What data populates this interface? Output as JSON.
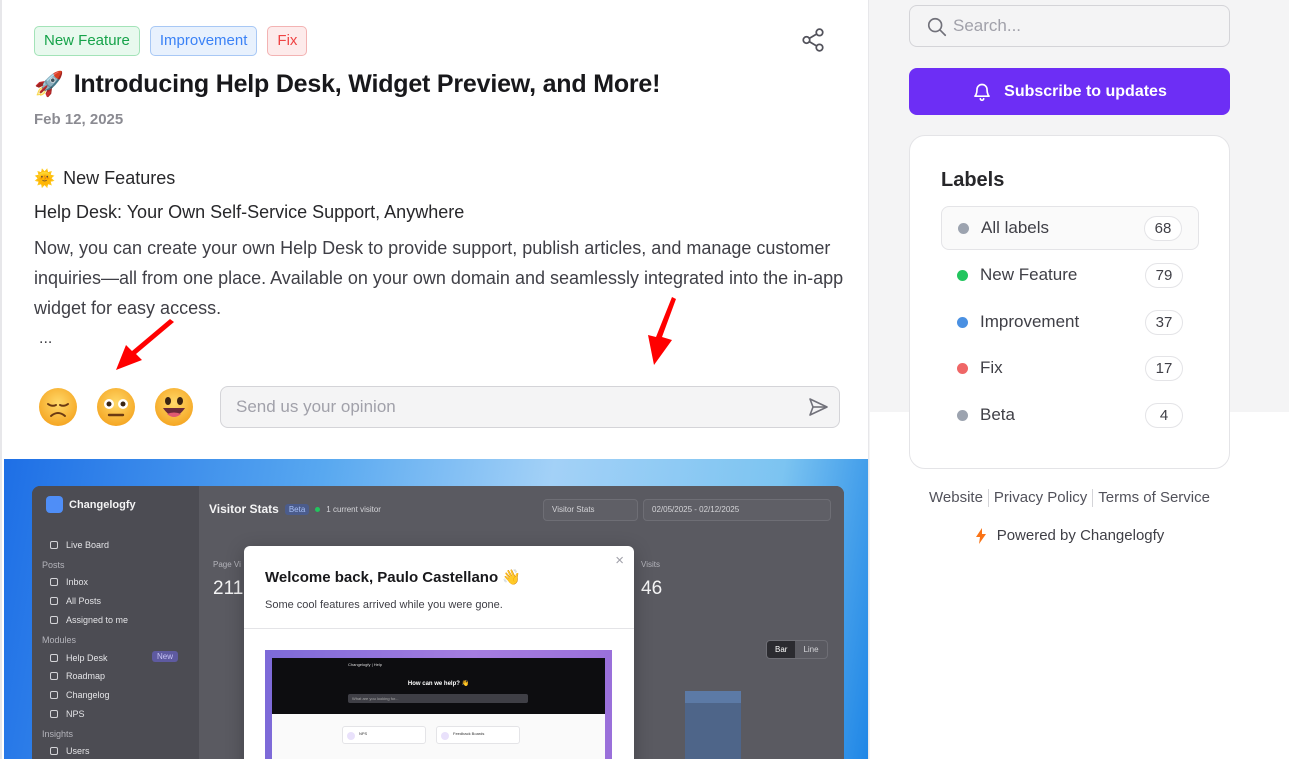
{
  "post": {
    "tags": [
      "New Feature",
      "Improvement",
      "Fix"
    ],
    "title": "Introducing Help Desk, Widget Preview, and More!",
    "title_emoji": "🚀",
    "date": "Feb 12, 2025",
    "section_emoji": "🌞",
    "section_title": "New Features",
    "subtitle": "Help Desk: Your Own Self-Service Support, Anywhere",
    "body": "Now, you can create your own Help Desk to provide support, publish articles, and manage customer inquiries—all from one place. Available on your own domain and seamlessly integrated into the in-app widget for easy access.",
    "ellipsis": "...",
    "opinion_placeholder": "Send us your opinion",
    "reactions": [
      "sad-face-icon",
      "neutral-face-icon",
      "happy-face-icon"
    ]
  },
  "preview": {
    "app_name": "Changelogfy",
    "sidebar": [
      {
        "type": "item",
        "label": "Live Board"
      },
      {
        "type": "group",
        "label": "Posts"
      },
      {
        "type": "item",
        "label": "Inbox"
      },
      {
        "type": "item",
        "label": "All Posts"
      },
      {
        "type": "item",
        "label": "Assigned to me"
      },
      {
        "type": "group",
        "label": "Modules"
      },
      {
        "type": "item",
        "label": "Help Desk"
      },
      {
        "type": "item",
        "label": "Roadmap"
      },
      {
        "type": "item",
        "label": "Changelog"
      },
      {
        "type": "item",
        "label": "NPS"
      },
      {
        "type": "group",
        "label": "Insights"
      },
      {
        "type": "item",
        "label": "Users"
      }
    ],
    "new_badge": "New",
    "stats_title": "Visitor Stats",
    "beta_badge": "Beta",
    "current_visitor": "1 current visitor",
    "select_view": "Visitor Stats",
    "date_range": "02/05/2025 - 02/12/2025",
    "page_views_label": "Page Vi",
    "page_views_value": "211",
    "visits_label": "Visits",
    "visits_value": "46",
    "toggle": [
      "Bar",
      "Line"
    ],
    "modal": {
      "title": "Welcome back, Paulo Castellano 👋",
      "subtitle": "Some cool features arrived while you were gone.",
      "close": "×",
      "hero_logo": "Changelogfy | Help",
      "hero_title": "How can we help? 👋",
      "hero_search": "What are you looking for...",
      "cards": [
        "NPS",
        "Feedback Boards"
      ]
    }
  },
  "sidebar": {
    "search_placeholder": "Search...",
    "subscribe_label": "Subscribe to updates",
    "labels_title": "Labels",
    "labels": [
      {
        "name": "All labels",
        "count": "68",
        "color": "#9ca3af"
      },
      {
        "name": "New Feature",
        "count": "79",
        "color": "#22c55e"
      },
      {
        "name": "Improvement",
        "count": "37",
        "color": "#4a90e2"
      },
      {
        "name": "Fix",
        "count": "17",
        "color": "#ef6666"
      },
      {
        "name": "Beta",
        "count": "4",
        "color": "#9ca3af"
      }
    ],
    "footer_links": [
      "Website",
      "Privacy Policy",
      "Terms of Service"
    ],
    "powered_by": "Powered by Changelogfy"
  },
  "colors": {
    "accent": "#6d2ef5",
    "annotation_arrow": "#ff0000"
  }
}
